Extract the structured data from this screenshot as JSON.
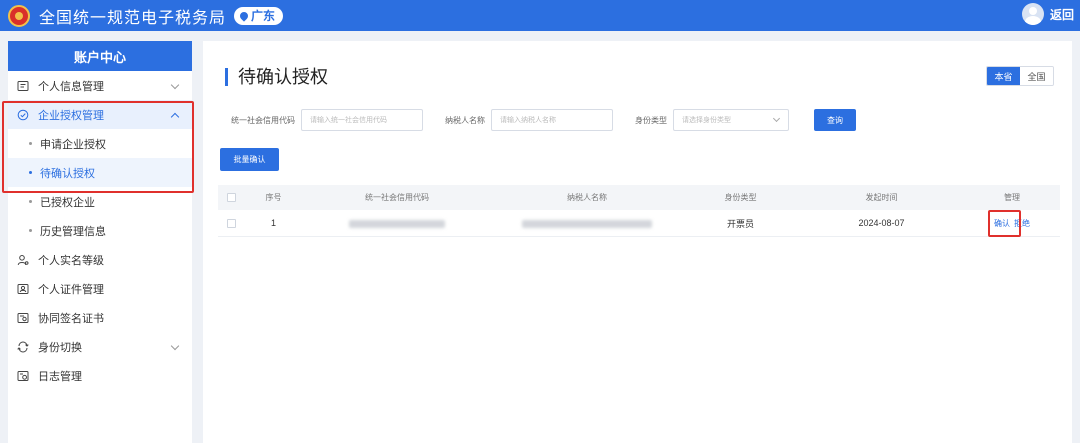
{
  "header": {
    "app_title": "全国统一规范电子税务局",
    "region": "广东",
    "back_label": "返回"
  },
  "sidebar": {
    "title": "账户中心",
    "items": [
      {
        "label": "个人信息管理",
        "icon": "profile-card-icon"
      },
      {
        "label": "企业授权管理",
        "icon": "authorize-check-icon"
      },
      {
        "label": "申请企业授权"
      },
      {
        "label": "待确认授权"
      },
      {
        "label": "已授权企业"
      },
      {
        "label": "历史管理信息"
      },
      {
        "label": "个人实名等级",
        "icon": "user-level-icon"
      },
      {
        "label": "个人证件管理",
        "icon": "id-card-icon"
      },
      {
        "label": "协同签名证书",
        "icon": "certificate-icon"
      },
      {
        "label": "身份切换",
        "icon": "switch-identity-icon"
      },
      {
        "label": "日志管理",
        "icon": "log-icon"
      }
    ]
  },
  "main": {
    "title": "待确认授权",
    "scope_tabs": [
      "本省",
      "全国"
    ],
    "filters": {
      "code_label": "统一社会信用代码",
      "code_placeholder": "请输入统一社会信用代码",
      "name_label": "纳税人名称",
      "name_placeholder": "请输入纳税人名称",
      "role_label": "身份类型",
      "role_placeholder": "请选择身份类型",
      "query_label": "查询"
    },
    "batch_label": "批量确认",
    "table": {
      "headers": [
        "序号",
        "统一社会信用代码",
        "纳税人名称",
        "身份类型",
        "发起时间",
        "管理"
      ],
      "rows": [
        {
          "no": "1",
          "role": "开票员",
          "time": "2024-08-07",
          "confirm": "确认",
          "reject": "拒绝"
        }
      ]
    }
  },
  "colors": {
    "brand": "#2c6fe0",
    "highlight": "#e0302c"
  }
}
